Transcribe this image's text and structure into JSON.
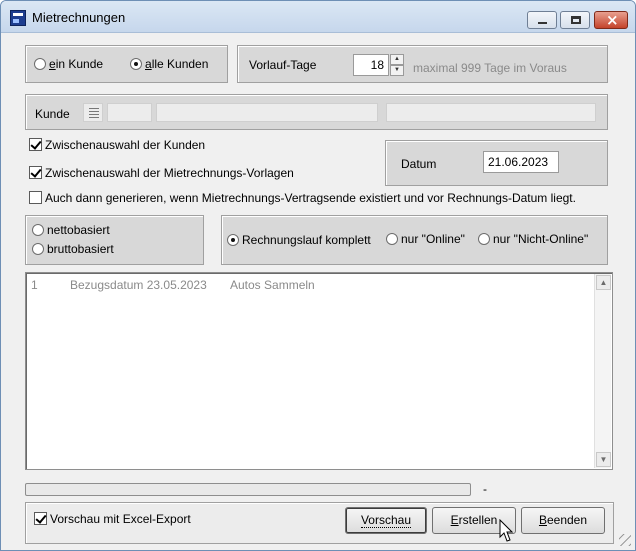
{
  "window": {
    "title": "Mietrechnungen"
  },
  "customers": {
    "one_label": "ein Kunde",
    "one_mnemonic": "e",
    "one_rest": "in Kunde",
    "all_mnemonic": "a",
    "all_rest": "lle Kunden",
    "selected": "alle Kunden"
  },
  "lead": {
    "label": "Vorlauf-Tage",
    "value": "18",
    "hint": "maximal 999 Tage im Voraus"
  },
  "customer_row": {
    "label": "Kunde"
  },
  "options": {
    "select_customers": "Zwischenauswahl der Kunden",
    "select_templates": "Zwischenauswahl der Mietrechnungs-Vorlagen",
    "generate_anyway": "Auch dann generieren, wenn Mietrechnungs-Vertragsende existiert und vor Rechnungs-Datum liegt."
  },
  "date": {
    "label": "Datum",
    "value": "21.06.2023"
  },
  "basis": {
    "net": "nettobasiert",
    "gross": "bruttobasiert"
  },
  "run": {
    "complete": "Rechnungslauf komplett",
    "online": "nur \"Online\"",
    "offline": "nur \"Nicht-Online\"",
    "selected": "Rechnungslauf komplett"
  },
  "list": {
    "rows": [
      {
        "nr": "1",
        "date": "Bezugsdatum 23.05.2023",
        "name": "Autos Sammeln"
      }
    ]
  },
  "progress": {
    "value": 0,
    "label": "-"
  },
  "footer": {
    "excel_export": "Vorschau mit Excel-Export",
    "preview": "Vorschau",
    "create": "Erstellen",
    "create_mnemonic": "E",
    "create_rest": "rstellen",
    "quit": "Beenden",
    "quit_mnemonic": "B",
    "quit_rest": "eenden"
  },
  "colors": {
    "panel": "#d8d8d8",
    "window": "#f0f0f0",
    "hint": "#8a8a8a"
  }
}
